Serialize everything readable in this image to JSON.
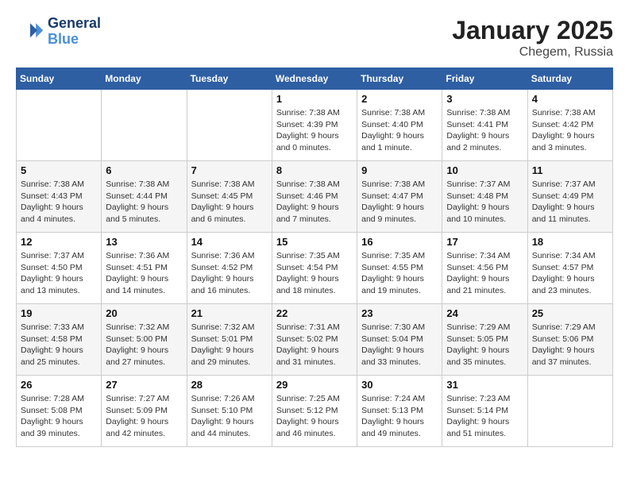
{
  "logo": {
    "line1": "General",
    "line2": "Blue"
  },
  "title": "January 2025",
  "location": "Chegem, Russia",
  "days_header": [
    "Sunday",
    "Monday",
    "Tuesday",
    "Wednesday",
    "Thursday",
    "Friday",
    "Saturday"
  ],
  "weeks": [
    [
      {
        "day": "",
        "info": ""
      },
      {
        "day": "",
        "info": ""
      },
      {
        "day": "",
        "info": ""
      },
      {
        "day": "1",
        "info": "Sunrise: 7:38 AM\nSunset: 4:39 PM\nDaylight: 9 hours\nand 0 minutes."
      },
      {
        "day": "2",
        "info": "Sunrise: 7:38 AM\nSunset: 4:40 PM\nDaylight: 9 hours\nand 1 minute."
      },
      {
        "day": "3",
        "info": "Sunrise: 7:38 AM\nSunset: 4:41 PM\nDaylight: 9 hours\nand 2 minutes."
      },
      {
        "day": "4",
        "info": "Sunrise: 7:38 AM\nSunset: 4:42 PM\nDaylight: 9 hours\nand 3 minutes."
      }
    ],
    [
      {
        "day": "5",
        "info": "Sunrise: 7:38 AM\nSunset: 4:43 PM\nDaylight: 9 hours\nand 4 minutes."
      },
      {
        "day": "6",
        "info": "Sunrise: 7:38 AM\nSunset: 4:44 PM\nDaylight: 9 hours\nand 5 minutes."
      },
      {
        "day": "7",
        "info": "Sunrise: 7:38 AM\nSunset: 4:45 PM\nDaylight: 9 hours\nand 6 minutes."
      },
      {
        "day": "8",
        "info": "Sunrise: 7:38 AM\nSunset: 4:46 PM\nDaylight: 9 hours\nand 7 minutes."
      },
      {
        "day": "9",
        "info": "Sunrise: 7:38 AM\nSunset: 4:47 PM\nDaylight: 9 hours\nand 9 minutes."
      },
      {
        "day": "10",
        "info": "Sunrise: 7:37 AM\nSunset: 4:48 PM\nDaylight: 9 hours\nand 10 minutes."
      },
      {
        "day": "11",
        "info": "Sunrise: 7:37 AM\nSunset: 4:49 PM\nDaylight: 9 hours\nand 11 minutes."
      }
    ],
    [
      {
        "day": "12",
        "info": "Sunrise: 7:37 AM\nSunset: 4:50 PM\nDaylight: 9 hours\nand 13 minutes."
      },
      {
        "day": "13",
        "info": "Sunrise: 7:36 AM\nSunset: 4:51 PM\nDaylight: 9 hours\nand 14 minutes."
      },
      {
        "day": "14",
        "info": "Sunrise: 7:36 AM\nSunset: 4:52 PM\nDaylight: 9 hours\nand 16 minutes."
      },
      {
        "day": "15",
        "info": "Sunrise: 7:35 AM\nSunset: 4:54 PM\nDaylight: 9 hours\nand 18 minutes."
      },
      {
        "day": "16",
        "info": "Sunrise: 7:35 AM\nSunset: 4:55 PM\nDaylight: 9 hours\nand 19 minutes."
      },
      {
        "day": "17",
        "info": "Sunrise: 7:34 AM\nSunset: 4:56 PM\nDaylight: 9 hours\nand 21 minutes."
      },
      {
        "day": "18",
        "info": "Sunrise: 7:34 AM\nSunset: 4:57 PM\nDaylight: 9 hours\nand 23 minutes."
      }
    ],
    [
      {
        "day": "19",
        "info": "Sunrise: 7:33 AM\nSunset: 4:58 PM\nDaylight: 9 hours\nand 25 minutes."
      },
      {
        "day": "20",
        "info": "Sunrise: 7:32 AM\nSunset: 5:00 PM\nDaylight: 9 hours\nand 27 minutes."
      },
      {
        "day": "21",
        "info": "Sunrise: 7:32 AM\nSunset: 5:01 PM\nDaylight: 9 hours\nand 29 minutes."
      },
      {
        "day": "22",
        "info": "Sunrise: 7:31 AM\nSunset: 5:02 PM\nDaylight: 9 hours\nand 31 minutes."
      },
      {
        "day": "23",
        "info": "Sunrise: 7:30 AM\nSunset: 5:04 PM\nDaylight: 9 hours\nand 33 minutes."
      },
      {
        "day": "24",
        "info": "Sunrise: 7:29 AM\nSunset: 5:05 PM\nDaylight: 9 hours\nand 35 minutes."
      },
      {
        "day": "25",
        "info": "Sunrise: 7:29 AM\nSunset: 5:06 PM\nDaylight: 9 hours\nand 37 minutes."
      }
    ],
    [
      {
        "day": "26",
        "info": "Sunrise: 7:28 AM\nSunset: 5:08 PM\nDaylight: 9 hours\nand 39 minutes."
      },
      {
        "day": "27",
        "info": "Sunrise: 7:27 AM\nSunset: 5:09 PM\nDaylight: 9 hours\nand 42 minutes."
      },
      {
        "day": "28",
        "info": "Sunrise: 7:26 AM\nSunset: 5:10 PM\nDaylight: 9 hours\nand 44 minutes."
      },
      {
        "day": "29",
        "info": "Sunrise: 7:25 AM\nSunset: 5:12 PM\nDaylight: 9 hours\nand 46 minutes."
      },
      {
        "day": "30",
        "info": "Sunrise: 7:24 AM\nSunset: 5:13 PM\nDaylight: 9 hours\nand 49 minutes."
      },
      {
        "day": "31",
        "info": "Sunrise: 7:23 AM\nSunset: 5:14 PM\nDaylight: 9 hours\nand 51 minutes."
      },
      {
        "day": "",
        "info": ""
      }
    ]
  ]
}
